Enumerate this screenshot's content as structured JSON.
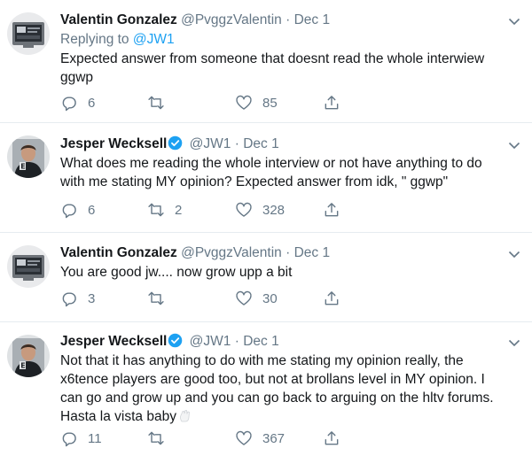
{
  "tweets": [
    {
      "name": "Valentin Gonzalez",
      "handle": "@PvggzValentin",
      "dot": "·",
      "time": "Dec 1",
      "replying_prefix": "Replying to",
      "replying_mention": "@JW1",
      "text_lines": [
        "Expected answer from someone that doesnt read the whole interwiew",
        "ggwp"
      ],
      "replies": "6",
      "retweets": "",
      "likes": "85",
      "verified": false
    },
    {
      "name": "Jesper Wecksell",
      "handle": "@JW1",
      "dot": "·",
      "time": "Dec 1",
      "text_lines": [
        "What does me reading the whole interview or not have anything to do",
        "with me stating MY opinion? Expected answer from idk, \"  ggwp\""
      ],
      "replies": "6",
      "retweets": "2",
      "likes": "328",
      "verified": true
    },
    {
      "name": "Valentin Gonzalez",
      "handle": "@PvggzValentin",
      "dot": "·",
      "time": "Dec 1",
      "text_lines": [
        "You are good jw.... now grow upp a bit"
      ],
      "replies": "3",
      "retweets": "",
      "likes": "30",
      "verified": false
    },
    {
      "name": "Jesper Wecksell",
      "handle": "@JW1",
      "dot": "·",
      "time": "Dec 1",
      "text_lines": [
        "Not that it has anything to do with me stating my opinion really, the",
        "x6tence players are good too, but not at brollans level in MY opinion. I",
        "can go and grow up and you can go back to arguing on the hltv forums.",
        "Hasta la vista baby"
      ],
      "replies": "11",
      "retweets": "",
      "likes": "367",
      "verified": true
    }
  ],
  "colors": {
    "accent": "#1da1f2",
    "secondary_text": "#657786",
    "primary_text": "#14171a",
    "divider": "#e6ecf0"
  },
  "icons": {
    "reply": "reply-icon",
    "retweet": "retweet-icon",
    "like": "like-icon",
    "share": "share-icon",
    "more": "chevron-down-icon",
    "verified": "verified-badge-icon"
  }
}
